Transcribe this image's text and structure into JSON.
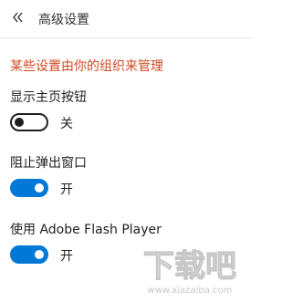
{
  "header": {
    "back_icon": "double-chevron-left-icon",
    "title": "高级设置"
  },
  "notice": {
    "text": "某些设置由你的组织来管理",
    "color": "#d2481f"
  },
  "settings": [
    {
      "label": "显示主页按钮",
      "state": "off",
      "state_label": "关"
    },
    {
      "label": "阻止弹出窗口",
      "state": "on",
      "state_label": "开"
    },
    {
      "label": "使用 Adobe Flash Player",
      "state": "on",
      "state_label": "开"
    }
  ],
  "accent_color": "#0078d7",
  "watermark": {
    "text": "下载吧",
    "subtext": "www.xiazaiba.com"
  }
}
